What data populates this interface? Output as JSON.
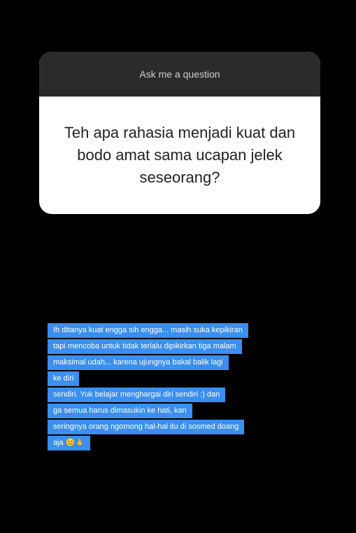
{
  "question_card": {
    "header": "Ask me a question",
    "question": "Teh apa rahasia menjadi kuat dan bodo amat sama ucapan jelek seseorang?"
  },
  "answer": {
    "lines": [
      "Ih ditanya kuat engga sih engga... masih suka kepikiran",
      "tapi mencoba untuk tidak terlalu dipikirkan tiga malam",
      "maksimal udah... karena ujungnya bakal balik lagi",
      "ke diri",
      "sendiri. Yuk belajar menghargai diri sendiri :) dan",
      "ga semua harus dimasukin ke hati, kan",
      "seringnya orang ngomong hal-hal itu di sosmed doang",
      "aja 😊🙏"
    ]
  },
  "colors": {
    "background": "#000000",
    "header_bg": "#2b2b2b",
    "card_bg": "#ffffff",
    "highlight": "#3a8ff0"
  }
}
